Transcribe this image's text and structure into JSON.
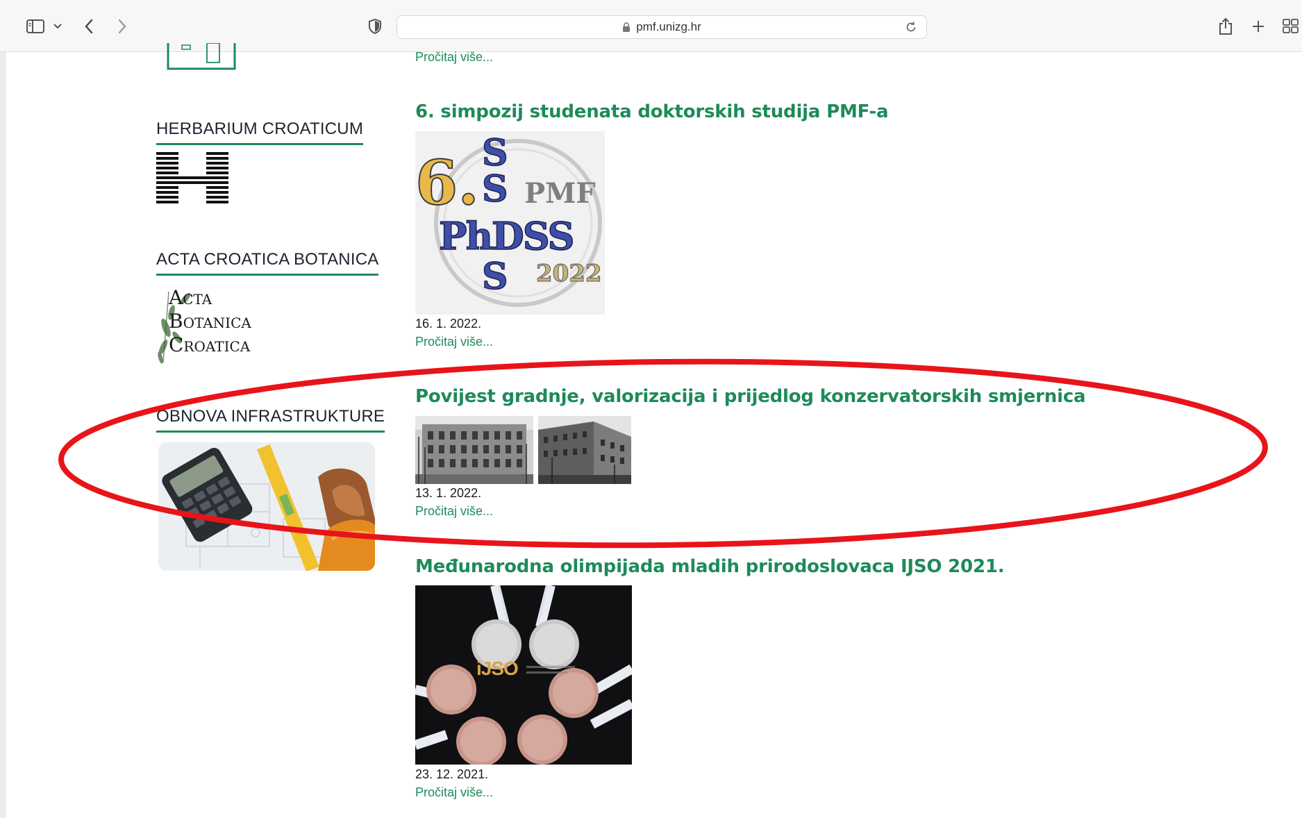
{
  "browser": {
    "url": "pmf.unizg.hr",
    "icons": [
      "sidebar-icon",
      "chevron-down-icon",
      "back-icon",
      "forward-icon",
      "shield-icon",
      "lock-icon",
      "reload-icon",
      "share-icon",
      "plus-icon",
      "tabs-grid-icon"
    ]
  },
  "sidebar": {
    "herbarium_title": "HERBARIUM CROATICUM",
    "acta_title": "ACTA CROATICA BOTANICA",
    "acta_logo_lines": [
      "Acta",
      "Botanica",
      "Croatica"
    ],
    "obnova_title": "OBNOVA INFRASTRUKTURE"
  },
  "articles": {
    "top_read_more": "Pročitaj više...",
    "items": [
      {
        "title": "6. simpozij studenata doktorskih studija PMF-a",
        "date": "16. 1. 2022.",
        "read_more": "Pročitaj više...",
        "image_text": {
          "six": "6.",
          "pmf": "PMF",
          "phdss": "PhDSS",
          "year": "2022",
          "s": "S"
        }
      },
      {
        "title": "Povijest gradnje, valorizacija i prijedlog konzervatorskih smjernica",
        "date": "13. 1. 2022.",
        "read_more": "Pročitaj više..."
      },
      {
        "title": "Međunarodna olimpijada mladih prirodoslovaca IJSO 2021.",
        "date": "23. 12. 2021.",
        "read_more": "Pročitaj više...",
        "image_text": {
          "logo": "iJSO"
        }
      }
    ]
  },
  "colors": {
    "accent": "#1e8a5a",
    "annotation": "#e8141a"
  }
}
